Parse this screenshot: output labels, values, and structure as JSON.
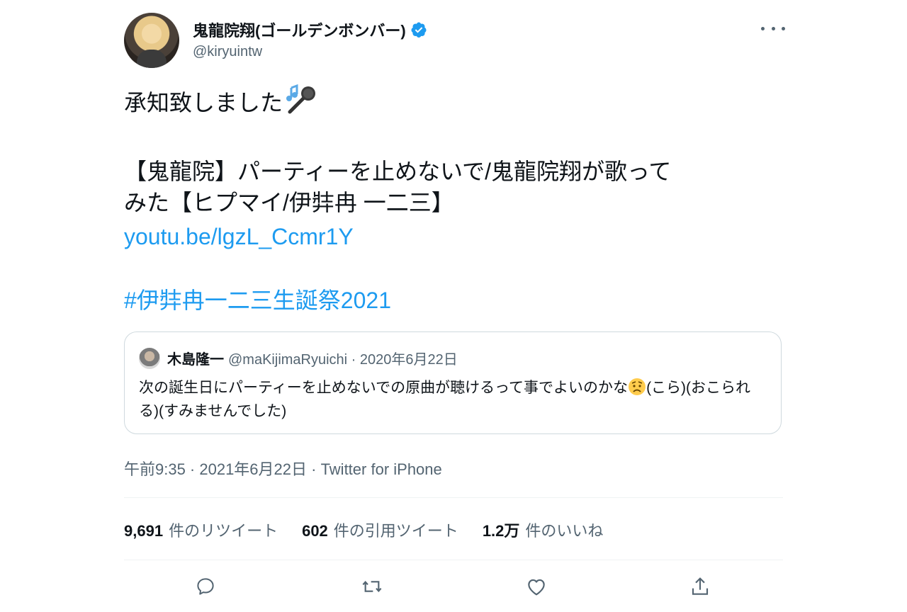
{
  "author": {
    "name": "鬼龍院翔(ゴールデンボンバー)",
    "handle": "@kiryuintw",
    "verified": true
  },
  "tweet": {
    "line1": "承知致しました",
    "line1_emoji": "microphone-with-music-notes",
    "line2": "【鬼龍院】パーティーを止めないで/鬼龍院翔が歌って",
    "line3": "みた【ヒプマイ/伊弉冉 一二三】",
    "link": "youtu.be/lgzL_Ccmr1Y",
    "hashtag": "#伊弉冉一二三生誕祭2021"
  },
  "quote": {
    "name": "木島隆一",
    "meta": "@maKijimaRyuichi · 2020年6月22日",
    "text_part1": "次の誕生日にパーティーを止めないでの原曲が聴けるって事でよいのかな",
    "text_emoji": "worried-face",
    "text_part2": "(こら)(おこられる)(すみませんでした)"
  },
  "timestamp": "午前9:35 · 2021年6月22日 · Twitter for iPhone",
  "stats": {
    "retweets": {
      "count": "9,691",
      "label": "件のリツイート"
    },
    "quotes": {
      "count": "602",
      "label": "件の引用ツイート"
    },
    "likes": {
      "count": "1.2万",
      "label": "件のいいね"
    }
  },
  "colors": {
    "link": "#1d9bf0",
    "verified": "#1d9bf0",
    "secondary_text": "#536471",
    "border": "#cfd9de"
  },
  "icons": [
    "verified-icon",
    "more-icon",
    "reply-icon",
    "retweet-icon",
    "like-icon",
    "share-icon"
  ]
}
